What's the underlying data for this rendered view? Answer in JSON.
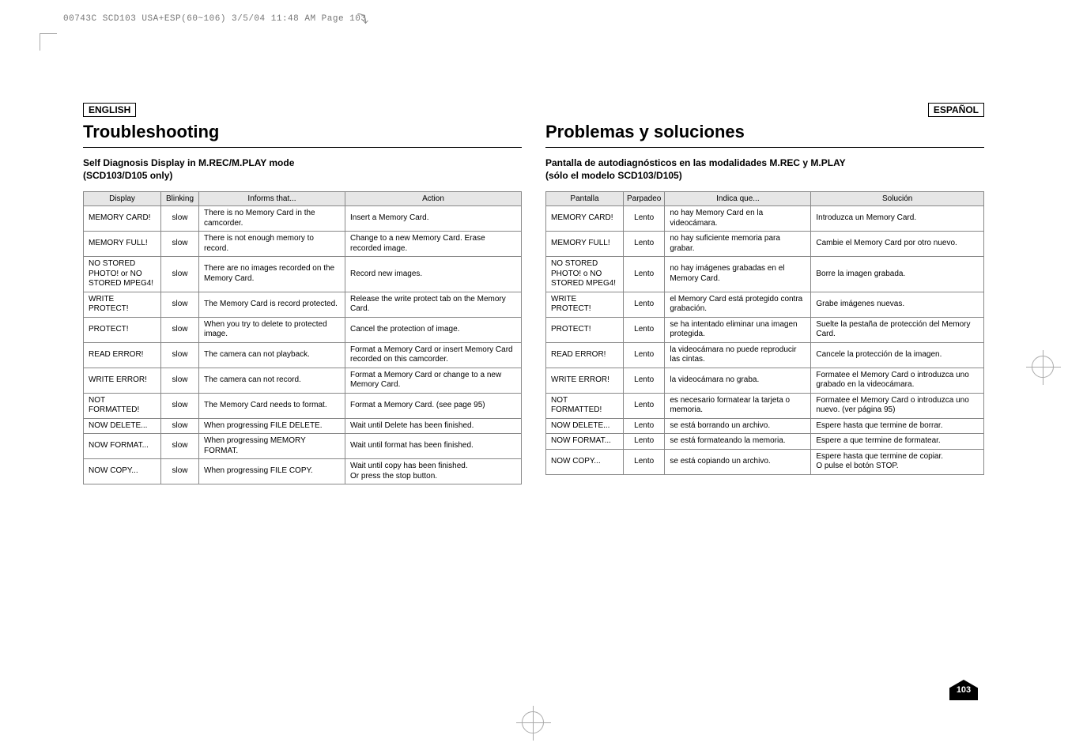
{
  "header_line": "00743C SCD103 USA+ESP(60~106)  3/5/04 11:48 AM  Page 103",
  "page_number": "103",
  "left": {
    "lang": "ENGLISH",
    "title": "Troubleshooting",
    "subtitle": "Self Diagnosis Display in M.REC/M.PLAY mode\n(SCD103/D105 only)",
    "th_display": "Display",
    "th_blink": "Blinking",
    "th_inform": "Informs that...",
    "th_action": "Action",
    "rows": [
      {
        "display": "MEMORY CARD!",
        "blink": "slow",
        "inform": "There is no Memory Card in the camcorder.",
        "action": "Insert a Memory Card."
      },
      {
        "display": "MEMORY FULL!",
        "blink": "slow",
        "inform": "There is not enough memory to record.",
        "action": "Change to a new Memory Card. Erase recorded image."
      },
      {
        "display": "NO STORED PHOTO! or NO STORED MPEG4!",
        "blink": "slow",
        "inform": "There are no images recorded on the Memory Card.",
        "action": "Record new images."
      },
      {
        "display": "WRITE PROTECT!",
        "blink": "slow",
        "inform": "The Memory Card is record protected.",
        "action": "Release the write protect tab on the Memory Card."
      },
      {
        "display": "PROTECT!",
        "blink": "slow",
        "inform": "When you try to delete to protected image.",
        "action": "Cancel the protection of image."
      },
      {
        "display": "READ ERROR!",
        "blink": "slow",
        "inform": "The camera can not playback.",
        "action": "Format a Memory Card or insert Memory Card recorded on this camcorder."
      },
      {
        "display": "WRITE ERROR!",
        "blink": "slow",
        "inform": "The camera can not record.",
        "action": "Format a Memory Card or change to a new Memory Card."
      },
      {
        "display": "NOT FORMATTED!",
        "blink": "slow",
        "inform": "The Memory Card needs to format.",
        "action": "Format a Memory Card. (see page 95)"
      },
      {
        "display": "NOW DELETE...",
        "blink": "slow",
        "inform": "When progressing FILE DELETE.",
        "action": "Wait until Delete has been finished."
      },
      {
        "display": "NOW FORMAT...",
        "blink": "slow",
        "inform": "When progressing MEMORY FORMAT.",
        "action": "Wait until format has been finished."
      },
      {
        "display": "NOW COPY...",
        "blink": "slow",
        "inform": "When progressing FILE COPY.",
        "action": "Wait until copy has been finished.\nOr press the stop button."
      }
    ]
  },
  "right": {
    "lang": "ESPAÑOL",
    "title": "Problemas y soluciones",
    "subtitle": "Pantalla de autodiagnósticos en las modalidades M.REC y M.PLAY\n(sólo el modelo SCD103/D105)",
    "th_display": "Pantalla",
    "th_blink": "Parpadeo",
    "th_inform": "Indica que...",
    "th_action": "Solución",
    "rows": [
      {
        "display": "MEMORY CARD!",
        "blink": "Lento",
        "inform": "no hay Memory Card en la videocámara.",
        "action": "Introduzca un Memory Card."
      },
      {
        "display": "MEMORY FULL!",
        "blink": "Lento",
        "inform": "no hay suficiente memoria para grabar.",
        "action": "Cambie el Memory Card por otro nuevo."
      },
      {
        "display": "NO STORED PHOTO! o NO STORED MPEG4!",
        "blink": "Lento",
        "inform": "no hay imágenes grabadas en el Memory Card.",
        "action": "Borre la imagen grabada."
      },
      {
        "display": "WRITE PROTECT!",
        "blink": "Lento",
        "inform": "el Memory Card está protegido contra grabación.",
        "action": "Grabe imágenes nuevas."
      },
      {
        "display": "PROTECT!",
        "blink": "Lento",
        "inform": "se ha intentado eliminar una imagen protegida.",
        "action": "Suelte la pestaña de protección del Memory Card."
      },
      {
        "display": "READ ERROR!",
        "blink": "Lento",
        "inform": "la videocámara no puede reproducir las cintas.",
        "action": "Cancele la protección de la imagen."
      },
      {
        "display": "WRITE ERROR!",
        "blink": "Lento",
        "inform": "la videocámara no graba.",
        "action": "Formatee el Memory Card o introduzca uno grabado en la videocámara."
      },
      {
        "display": "NOT FORMATTED!",
        "blink": "Lento",
        "inform": "es necesario formatear la tarjeta o memoria.",
        "action": "Formatee el Memory Card o introduzca uno nuevo. (ver página 95)"
      },
      {
        "display": "NOW DELETE...",
        "blink": "Lento",
        "inform": "se está borrando un archivo.",
        "action": "Espere hasta que termine de borrar."
      },
      {
        "display": "NOW FORMAT...",
        "blink": "Lento",
        "inform": "se está formateando la memoria.",
        "action": "Espere a que termine de formatear."
      },
      {
        "display": "NOW COPY...",
        "blink": "Lento",
        "inform": "se está copiando un archivo.",
        "action": "Espere hasta que termine de copiar.\nO pulse el botón STOP."
      }
    ]
  }
}
